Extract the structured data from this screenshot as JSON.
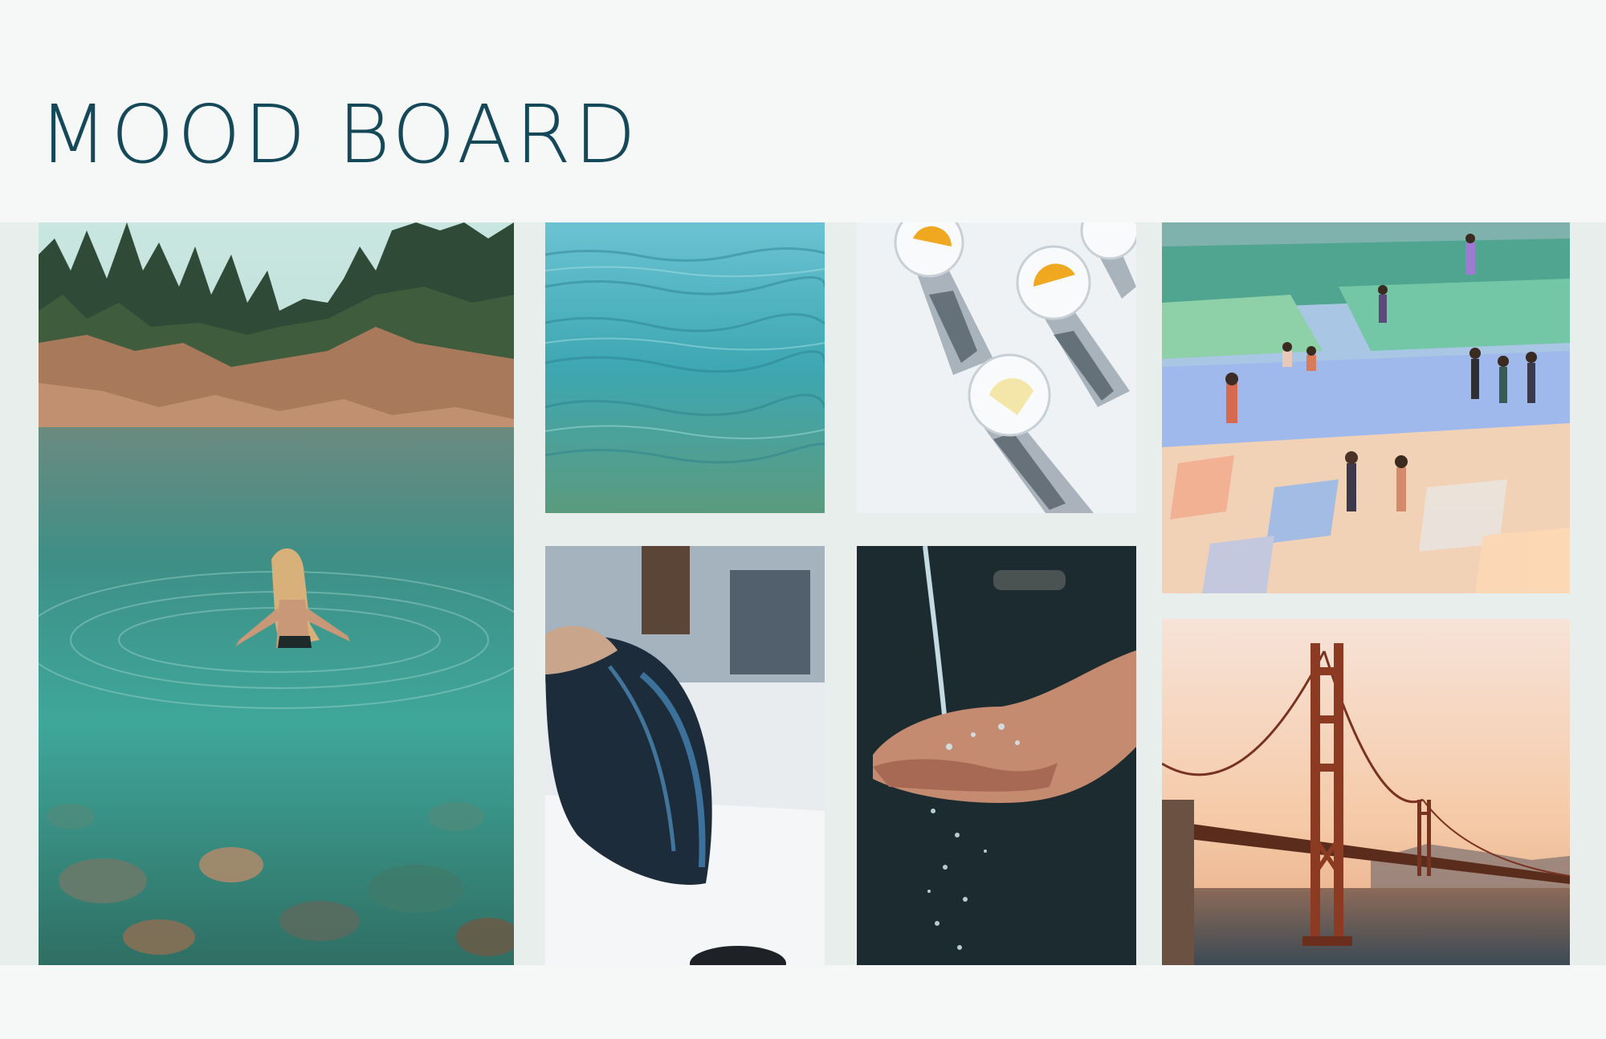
{
  "page": {
    "title": "MOOD BOARD",
    "colors": {
      "title": "#15495a",
      "background": "#f6f7f7",
      "band": "#e7eeec"
    }
  },
  "board": {
    "images": [
      {
        "id": "river",
        "subject": "woman-wading-in-clear-river-photo"
      },
      {
        "id": "water",
        "subject": "calm-turquoise-water-surface-photo"
      },
      {
        "id": "glasses",
        "subject": "glasses-with-lemon-slices-photo"
      },
      {
        "id": "painting",
        "subject": "beach-people-painting"
      },
      {
        "id": "hair",
        "subject": "hair-wash-photo"
      },
      {
        "id": "hands",
        "subject": "water-pouring-into-hands-photo"
      },
      {
        "id": "bridge",
        "subject": "golden-gate-bridge-sunset-photo"
      }
    ]
  }
}
